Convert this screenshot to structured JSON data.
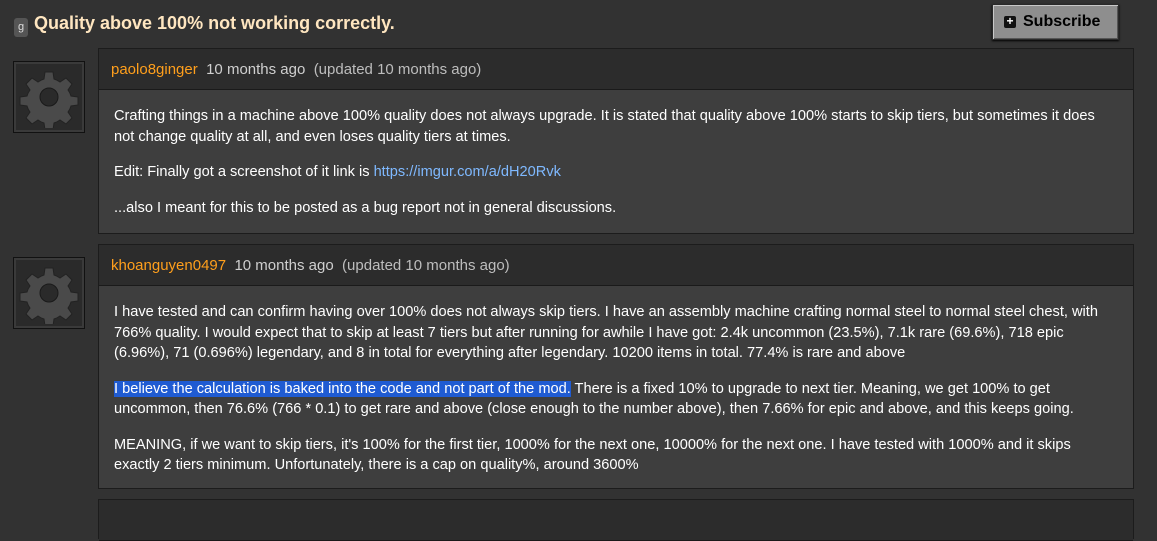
{
  "header": {
    "tag": "g",
    "title": "Quality above 100% not working correctly.",
    "subscribe_label": "Subscribe"
  },
  "posts": [
    {
      "author": "paolo8ginger",
      "time": "10 months ago",
      "updated": "(updated 10 months ago)",
      "p1": "Crafting things in a machine above 100% quality does not always upgrade. It is stated that quality above 100% starts to skip tiers, but sometimes it does not change quality at all, and even loses quality tiers at times.",
      "p2_prefix": "Edit: Finally got a screenshot of it link is ",
      "p2_link": "https://imgur.com/a/dH20Rvk",
      "p3": "...also I meant for this to be posted as a bug report not in general discussions."
    },
    {
      "author": "khoanguyen0497",
      "time": "10 months ago",
      "updated": "(updated 10 months ago)",
      "p1": "I have tested and can confirm having over 100% does not always skip tiers. I have an assembly machine crafting normal steel to normal steel chest, with 766% quality. I would expect that to skip at least 7 tiers but after running for awhile I have got: 2.4k uncommon (23.5%), 7.1k rare (69.6%), 718 epic (6.96%), 71 (0.696%) legendary, and 8 in total for everything after legendary. 10200 items in total. 77.4% is rare and above",
      "p2_highlight": "I believe the calculation is baked into the code and not part of the mod.",
      "p2_rest": " There is a fixed 10% to upgrade to next tier. Meaning, we get 100% to get uncommon, then 76.6% (766 * 0.1) to get rare and above (close enough to the number above), then 7.66% for epic and above, and this keeps going.",
      "p3": "MEANING, if we want to skip tiers, it's 100% for the first tier, 1000% for the next one, 10000% for the next one. I have tested with 1000% and it skips exactly 2 tiers minimum. Unfortunately, there is a cap on quality%, around 3600%"
    }
  ],
  "icons": {
    "avatar": "gear-icon",
    "subscribe": "plus-icon"
  },
  "colors": {
    "author": "#ff9f1c",
    "title": "#ffe6c0",
    "link": "#7fb9ff",
    "highlight": "#1f5bd2"
  }
}
